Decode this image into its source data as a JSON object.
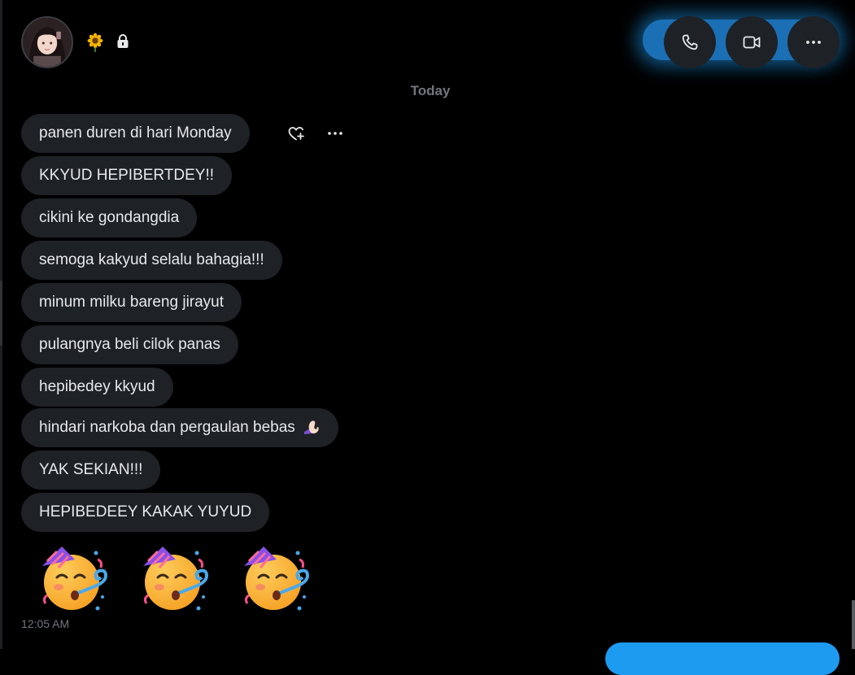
{
  "header": {
    "name_emoji": "sunflower",
    "lock": "lock-icon",
    "buttons": [
      "phone-icon",
      "video-icon",
      "more-icon"
    ]
  },
  "day_divider": "Today",
  "messages": [
    "panen duren di hari Monday",
    "KKYUD HEPIBERTDEY!!",
    "cikini ke gondangdia",
    "semoga kakyud selalu bahagia!!!",
    "minum milku bareng jirayut",
    "pulangnya beli cilok panas",
    "hepibedey kkyud",
    "hindari narkoba dan pergaulan bebas",
    "YAK SEKIAN!!!",
    "HEPIBEDEEY KAKAK YUYUD"
  ],
  "emoji_message": [
    "partying-face",
    "partying-face",
    "partying-face"
  ],
  "timestamp": "12:05 AM",
  "colors": {
    "background": "#000000",
    "bubble": "#1e2126",
    "text": "#e7e9ea",
    "muted": "#71767b",
    "accent": "#1d9bf0"
  }
}
